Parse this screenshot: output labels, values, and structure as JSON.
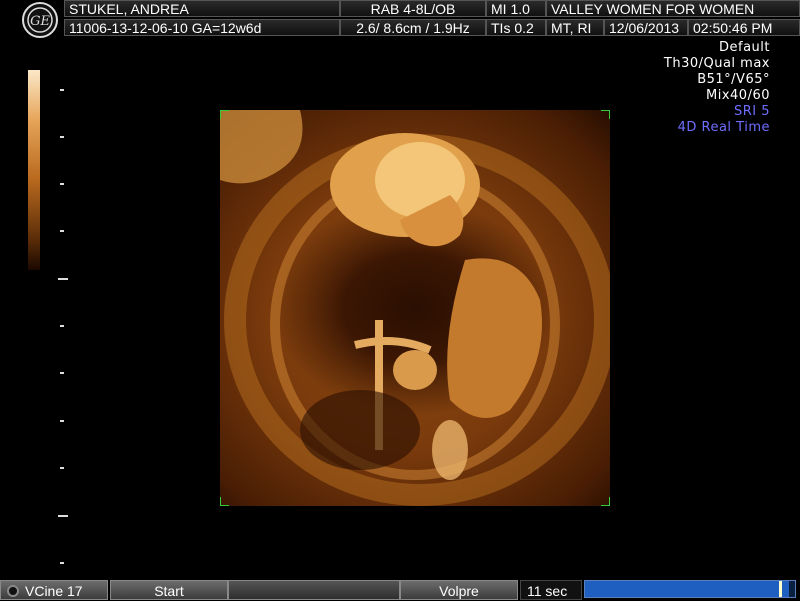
{
  "header": {
    "patient_name": "STUKEL, ANDREA",
    "patient_id": "11006-13-12-06-10  GA=12w6d",
    "probe": "RAB 4-8L/OB",
    "depth_freq": "2.6/ 8.6cm / 1.9Hz",
    "mi": "MI  1.0",
    "tis": "TIs  0.2",
    "institution": "VALLEY WOMEN FOR WOMEN",
    "operator": "MT, RI",
    "date": "12/06/2013",
    "time": "02:50:46 PM"
  },
  "params": {
    "preset": "Default",
    "threshold_quality": "Th30/Qual max",
    "angles": "B51°/V65°",
    "mix": "Mix40/60",
    "sri": "SRI 5",
    "mode": "4D Real Time"
  },
  "colors": {
    "accent_param": "#6f6fff",
    "progress_fill": "#1f5fbf",
    "progress_marker": "#ffffcc"
  },
  "footer": {
    "vcine_label": "VCine 17",
    "start_label": "Start",
    "volpre_label": "Volpre",
    "duration": "11 sec",
    "progress_fraction": 0.97
  },
  "icons": {
    "logo": "ge-logo-icon",
    "vcine": "record-dot-icon"
  }
}
